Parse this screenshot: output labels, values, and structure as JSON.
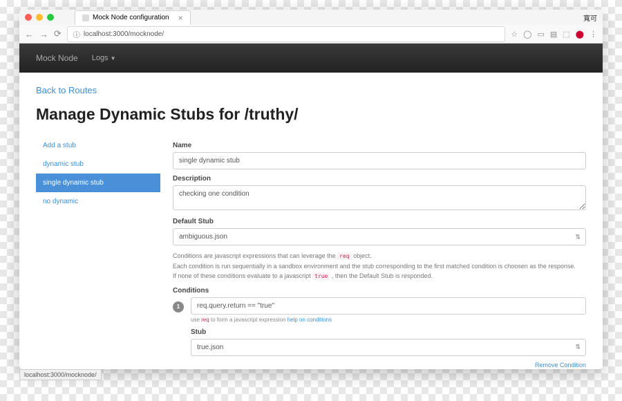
{
  "browser": {
    "tab_title": "Mock Node configuration",
    "url": "localhost:3000/mocknode/",
    "right_text": "寬可"
  },
  "navbar": {
    "brand": "Mock Node",
    "logs_label": "Logs"
  },
  "page": {
    "back_link": "Back to Routes",
    "title": "Manage Dynamic Stubs for /truthy/"
  },
  "sidebar": {
    "items": [
      {
        "label": "Add a stub",
        "active": false
      },
      {
        "label": "dynamic stub",
        "active": false
      },
      {
        "label": "single dynamic stub",
        "active": true
      },
      {
        "label": "no dynamic",
        "active": false
      }
    ]
  },
  "form": {
    "name_label": "Name",
    "name_value": "single dynamic stub",
    "desc_label": "Description",
    "desc_value": "checking one condition",
    "default_stub_label": "Default Stub",
    "default_stub_value": "ambiguous.json",
    "help_line1_pre": "Conditions are javascript expressions that can leverage the ",
    "help_line1_code": "req",
    "help_line1_post": " object.",
    "help_line2": "Each condition is run sequentially in a sandbox environment and the stub corresponding to the first matched condition is choosen as the response.",
    "help_line3_pre": "If none of these conditions evaluate to a javascript ",
    "help_line3_code": "true",
    "help_line3_post": " , then the Default Stub is responded.",
    "conditions_label": "Conditions",
    "condition_index": "1",
    "condition_value": "req.query.return == \"true\"",
    "hint_pre": "use ",
    "hint_code": "req",
    "hint_mid": " to form a javascript expression ",
    "hint_link": "help on conditions",
    "stub_label": "Stub",
    "stub_value": "true.json",
    "remove_label": "Remove Condition"
  },
  "statusbar": "localhost:3000/mocknode/"
}
